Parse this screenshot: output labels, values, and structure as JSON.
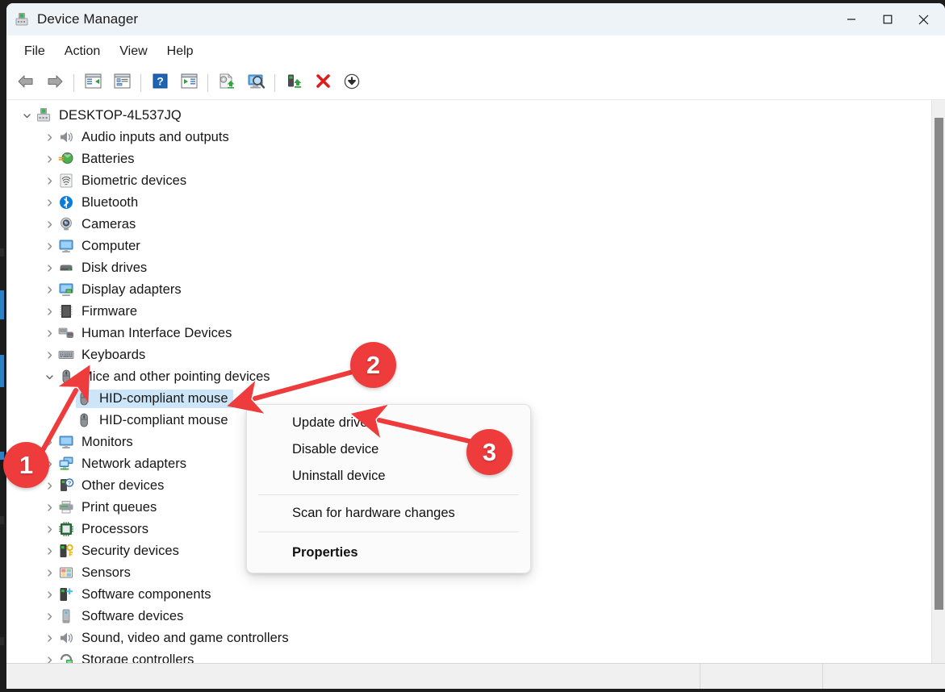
{
  "window": {
    "title": "Device Manager",
    "app_icon": "device-manager-icon",
    "controls": {
      "minimize": "minimize-icon",
      "maximize": "maximize-icon",
      "close": "close-icon"
    }
  },
  "menubar": {
    "items": [
      {
        "label": "File"
      },
      {
        "label": "Action"
      },
      {
        "label": "View"
      },
      {
        "label": "Help"
      }
    ]
  },
  "toolbar": {
    "buttons": [
      {
        "icon": "back-arrow-icon",
        "name": "back-button"
      },
      {
        "icon": "forward-arrow-icon",
        "name": "forward-button"
      },
      {
        "separator": true
      },
      {
        "icon": "show-hide-console-tree-icon",
        "name": "show-hide-console-tree-button"
      },
      {
        "icon": "properties-window-icon",
        "name": "properties-button"
      },
      {
        "separator": true
      },
      {
        "icon": "help-icon",
        "name": "help-button"
      },
      {
        "icon": "show-hide-action-pane-icon",
        "name": "show-hide-action-pane-button"
      },
      {
        "separator": true
      },
      {
        "icon": "update-driver-icon",
        "name": "update-driver-button"
      },
      {
        "icon": "scan-for-hardware-changes-icon",
        "name": "scan-hardware-changes-button"
      },
      {
        "separator": true
      },
      {
        "icon": "uninstall-device-icon",
        "name": "uninstall-device-button"
      },
      {
        "icon": "disable-device-icon",
        "name": "disable-device-button"
      },
      {
        "icon": "enable-device-icon",
        "name": "enable-device-button"
      }
    ]
  },
  "tree": {
    "root": {
      "label": "DESKTOP-4L537JQ",
      "icon": "computer-root-icon",
      "expanded": true,
      "twisty": "chevron-down"
    },
    "items": [
      {
        "label": "Audio inputs and outputs",
        "icon": "speaker-icon",
        "twisty": "chevron-right",
        "indent": 1
      },
      {
        "label": "Batteries",
        "icon": "battery-icon",
        "twisty": "chevron-right",
        "indent": 1
      },
      {
        "label": "Biometric devices",
        "icon": "fingerprint-icon",
        "twisty": "chevron-right",
        "indent": 1
      },
      {
        "label": "Bluetooth",
        "icon": "bluetooth-icon",
        "twisty": "chevron-right",
        "indent": 1
      },
      {
        "label": "Cameras",
        "icon": "camera-icon",
        "twisty": "chevron-right",
        "indent": 1
      },
      {
        "label": "Computer",
        "icon": "monitor-icon",
        "twisty": "chevron-right",
        "indent": 1
      },
      {
        "label": "Disk drives",
        "icon": "disk-drive-icon",
        "twisty": "chevron-right",
        "indent": 1
      },
      {
        "label": "Display adapters",
        "icon": "display-adapter-icon",
        "twisty": "chevron-right",
        "indent": 1
      },
      {
        "label": "Firmware",
        "icon": "firmware-chip-icon",
        "twisty": "chevron-right",
        "indent": 1
      },
      {
        "label": "Human Interface Devices",
        "icon": "hid-icon",
        "twisty": "chevron-right",
        "indent": 1
      },
      {
        "label": "Keyboards",
        "icon": "keyboard-icon",
        "twisty": "chevron-right",
        "indent": 1
      },
      {
        "label": "Mice and other pointing devices",
        "icon": "mouse-icon",
        "twisty": "chevron-down",
        "indent": 1,
        "expanded": true
      },
      {
        "label": "HID-compliant mouse",
        "icon": "mouse-icon",
        "twisty": "none",
        "indent": 2,
        "selected": true
      },
      {
        "label": "HID-compliant mouse",
        "icon": "mouse-icon",
        "twisty": "none",
        "indent": 2
      },
      {
        "label": "Monitors",
        "icon": "monitor-icon",
        "twisty": "chevron-right",
        "indent": 1
      },
      {
        "label": "Network adapters",
        "icon": "network-adapter-icon",
        "twisty": "chevron-right",
        "indent": 1
      },
      {
        "label": "Other devices",
        "icon": "unknown-device-icon",
        "twisty": "chevron-right",
        "indent": 1
      },
      {
        "label": "Print queues",
        "icon": "printer-icon",
        "twisty": "chevron-right",
        "indent": 1
      },
      {
        "label": "Processors",
        "icon": "processor-icon",
        "twisty": "chevron-right",
        "indent": 1
      },
      {
        "label": "Security devices",
        "icon": "security-device-icon",
        "twisty": "chevron-right",
        "indent": 1
      },
      {
        "label": "Sensors",
        "icon": "sensor-icon",
        "twisty": "chevron-right",
        "indent": 1
      },
      {
        "label": "Software components",
        "icon": "software-component-icon",
        "twisty": "chevron-right",
        "indent": 1
      },
      {
        "label": "Software devices",
        "icon": "software-device-icon",
        "twisty": "chevron-right",
        "indent": 1
      },
      {
        "label": "Sound, video and game controllers",
        "icon": "speaker-icon",
        "twisty": "chevron-right",
        "indent": 1
      },
      {
        "label": "Storage controllers",
        "icon": "storage-controller-icon",
        "twisty": "chevron-right",
        "indent": 1
      }
    ]
  },
  "context_menu": {
    "items": [
      {
        "label": "Update driver",
        "type": "item",
        "name": "ctx-update-driver"
      },
      {
        "label": "Disable device",
        "type": "item",
        "name": "ctx-disable-device"
      },
      {
        "label": "Uninstall device",
        "type": "item",
        "name": "ctx-uninstall-device"
      },
      {
        "type": "separator"
      },
      {
        "label": "Scan for hardware changes",
        "type": "item",
        "name": "ctx-scan-hardware-changes"
      },
      {
        "type": "separator"
      },
      {
        "label": "Properties",
        "type": "item",
        "bold": true,
        "name": "ctx-properties"
      }
    ]
  },
  "annotations": {
    "accent_color": "#ee3b3b",
    "badges": [
      {
        "number": "1"
      },
      {
        "number": "2"
      },
      {
        "number": "3"
      }
    ]
  },
  "statusbar": {
    "main": "",
    "cell_1": "",
    "cell_2": ""
  }
}
